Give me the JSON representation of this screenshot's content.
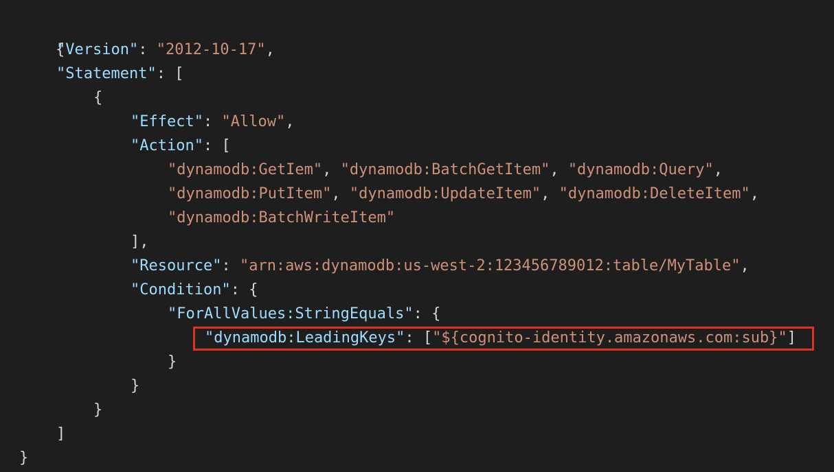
{
  "code": {
    "open_root": "{",
    "version_key": "\"Version\"",
    "version_value": "\"2012-10-17\"",
    "statement_key": "\"Statement\"",
    "statement_open": "[",
    "stmt_open": "{",
    "effect_key": "\"Effect\"",
    "effect_value": "\"Allow\"",
    "action_key": "\"Action\"",
    "action_open": "[",
    "actions": [
      "\"dynamodb:GetIem\"",
      "\"dynamodb:BatchGetItem\"",
      "\"dynamodb:Query\"",
      "\"dynamodb:PutItem\"",
      "\"dynamodb:UpdateItem\"",
      "\"dynamodb:DeleteItem\"",
      "\"dynamodb:BatchWriteItem\""
    ],
    "action_close": "],",
    "resource_key": "\"Resource\"",
    "resource_value": "\"arn:aws:dynamodb:us-west-2:123456789012:table/MyTable\"",
    "condition_key": "\"Condition\"",
    "condition_open": "{",
    "forall_key": "\"ForAllValues:StringEquals\"",
    "forall_open": "{",
    "leading_keys_key": "\"dynamodb:LeadingKeys\"",
    "leading_keys_value": "\"${cognito-identity.amazonaws.com:sub}\"",
    "forall_close": "}",
    "condition_close": "}",
    "stmt_close": "}",
    "statement_close": "]",
    "close_root": "}"
  },
  "colors": {
    "background": "#1e1e1e",
    "key": "#9cdcfe",
    "string": "#ce9178",
    "punctuation": "#d4d4d4",
    "highlight_border": "#e0321f"
  }
}
